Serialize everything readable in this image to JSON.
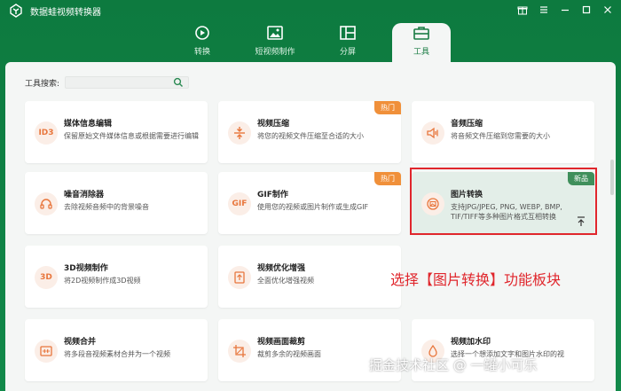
{
  "app": {
    "title": "数据蛙视频转换器"
  },
  "window_controls": [
    "gift-icon",
    "menu-icon",
    "minimize-icon",
    "maximize-icon",
    "close-icon"
  ],
  "nav": {
    "tabs": [
      {
        "label": "转换",
        "icon": "convert-icon"
      },
      {
        "label": "短视频制作",
        "icon": "short-video-icon"
      },
      {
        "label": "分屏",
        "icon": "split-screen-icon"
      },
      {
        "label": "工具",
        "icon": "toolbox-icon",
        "active": true
      }
    ]
  },
  "search": {
    "label": "工具搜索:",
    "value": ""
  },
  "cards": [
    {
      "title": "媒体信息编辑",
      "desc": "保留原始文件媒体信息或根据需要进行编辑",
      "icon": "ID3"
    },
    {
      "title": "视频压缩",
      "desc": "将您的视频文件压缩至合适的大小",
      "icon": "compress-icon",
      "badge": "热门"
    },
    {
      "title": "音频压缩",
      "desc": "将音频文件压缩到您需要的大小",
      "icon": "audio-compress-icon"
    },
    {
      "title": "噪音消除器",
      "desc": "去除视频音频中的背景噪音",
      "icon": "headphone-icon"
    },
    {
      "title": "GIF制作",
      "desc": "使用您的视频或图片制作或生成GIF",
      "icon": "GIF",
      "badge": "热门"
    },
    {
      "title": "图片转换",
      "desc": "支持JPG/JPEG, PNG, WEBP, BMP, TIF/TIFF等多种图片格式互相转换",
      "icon": "image-convert-icon",
      "badge": "新品"
    },
    {
      "title": "3D视频制作",
      "desc": "将2D视频制作成3D视频",
      "icon": "3D"
    },
    {
      "title": "视频优化增强",
      "desc": "全面优化增强视频",
      "icon": "enhance-icon"
    },
    {
      "title": "视频合并",
      "desc": "将多段音视频素材合并为一个视频",
      "icon": "merge-icon"
    },
    {
      "title": "视频画面裁剪",
      "desc": "裁剪多余的视频画面",
      "icon": "crop-icon"
    },
    {
      "title": "视频加水印",
      "desc": "选择一个想添加文字和图片水印的视",
      "icon": "watermark-icon"
    }
  ],
  "annotation": "选择【图片转换】功能板块",
  "watermark": "掘金技术社区 @ 一罐小可乐",
  "colors": {
    "brand_green": "#12894a",
    "accent_orange": "#e8763c",
    "hot_badge": "#f0903a",
    "new_badge": "#3f8f5b",
    "highlight_red": "#e0262c"
  }
}
